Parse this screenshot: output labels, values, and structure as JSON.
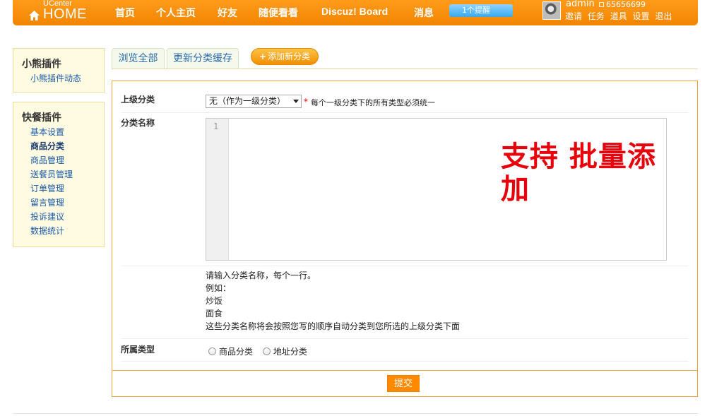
{
  "header": {
    "logo_small": "UCenter",
    "logo_big": "HOME",
    "nav": [
      "首页",
      "个人主页",
      "好友",
      "随便看看",
      "Discuz! Board",
      "消息"
    ],
    "notice": "1个提醒",
    "user": {
      "name": "admin",
      "credit": "65656699",
      "links": [
        "邀请",
        "任务",
        "道具",
        "设置",
        "退出"
      ]
    }
  },
  "sidebar": {
    "box1": {
      "title": "小熊插件",
      "items": [
        "小熊插件动态"
      ]
    },
    "box2": {
      "title": "快餐插件",
      "items": [
        "基本设置",
        "商品分类",
        "商品管理",
        "送餐员管理",
        "订单管理",
        "留言管理",
        "投诉建议",
        "数据统计"
      ],
      "active_index": 1
    }
  },
  "tabs": {
    "browse_all": "浏览全部",
    "refresh_cache": "更新分类缓存",
    "add_new": "添加新分类"
  },
  "form": {
    "parent_label": "上级分类",
    "parent_select_value": "无（作为一级分类）",
    "parent_hint": "每个一级分类下的所有类型必须统一",
    "name_label": "分类名称",
    "editor_line_number": "1",
    "overlay_text": "支持 批量添加",
    "notes": [
      "请输入分类名称，每个一行。",
      "例如：",
      "炒饭",
      "面食",
      "这些分类名称将会按照您写的顺序自动分类到您所选的上级分类下面"
    ],
    "type_label": "所属类型",
    "type_options": [
      "商品分类",
      "地址分类"
    ],
    "submit": "提交"
  },
  "colors": {
    "header_orange": "#f28500",
    "accent_orange": "#ff8a00",
    "overlay_red": "#e8000b",
    "link_blue": "#1a5aa6"
  }
}
